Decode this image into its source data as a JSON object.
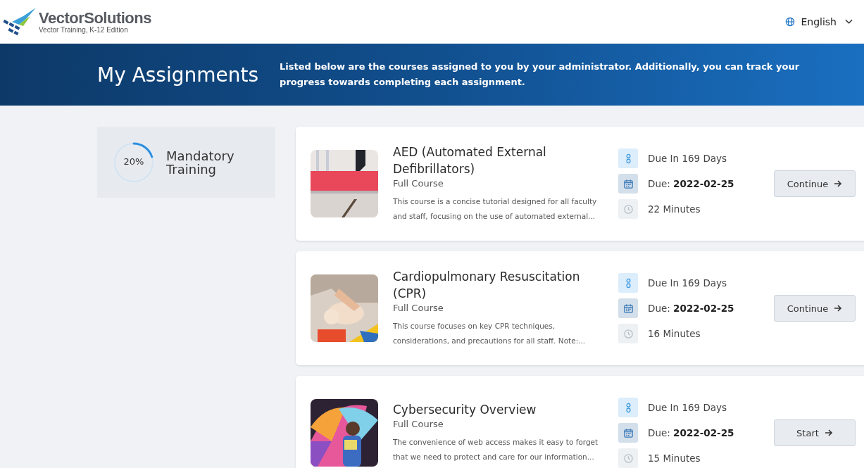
{
  "header": {
    "brand": "VectorSolutions",
    "edition": "Vector Training, K-12 Edition",
    "language": "English"
  },
  "banner": {
    "title": "My Assignments",
    "description": "Listed below are the courses assigned to you by your administrator. Additionally, you can track your progress towards completing each assignment."
  },
  "sidebar": {
    "progress": {
      "label": "20%",
      "level": 0.2,
      "name": "Mandatory Training"
    }
  },
  "courses": [
    {
      "title": "AED (Automated External Defibrillators)",
      "type": "Full Course",
      "description": "This course is a concise tutorial designed for all faculty and staff, focusing on the use of automated external...",
      "meta": [
        {
          "kind": "due_in",
          "text": "Due In 169 Days"
        },
        {
          "kind": "due_date",
          "text": "Due: **2022-02-25**"
        },
        {
          "kind": "duration",
          "text": "22 Minutes"
        }
      ],
      "action": "Continue"
    },
    {
      "title": "Cardiopulmonary Resuscitation (CPR)",
      "type": "Full Course",
      "description": "This course focuses on key CPR techniques, considerations, and precautions for all staff. Note:...",
      "meta": [
        {
          "kind": "due_in",
          "text": "Due In 169 Days"
        },
        {
          "kind": "due_date",
          "text": "Due: **2022-02-25**"
        },
        {
          "kind": "duration",
          "text": "16 Minutes"
        }
      ],
      "action": "Continue"
    },
    {
      "title": "Cybersecurity Overview",
      "type": "Full Course",
      "description": "The convenience of web access makes it easy to forget that we need to protect and care for our information...",
      "meta": [
        {
          "kind": "due_in",
          "text": "Due In 169 Days"
        },
        {
          "kind": "due_date",
          "text": "Due: **2022-02-25**"
        },
        {
          "kind": "duration",
          "text": "15 Minutes"
        }
      ],
      "action": "Start"
    }
  ]
}
